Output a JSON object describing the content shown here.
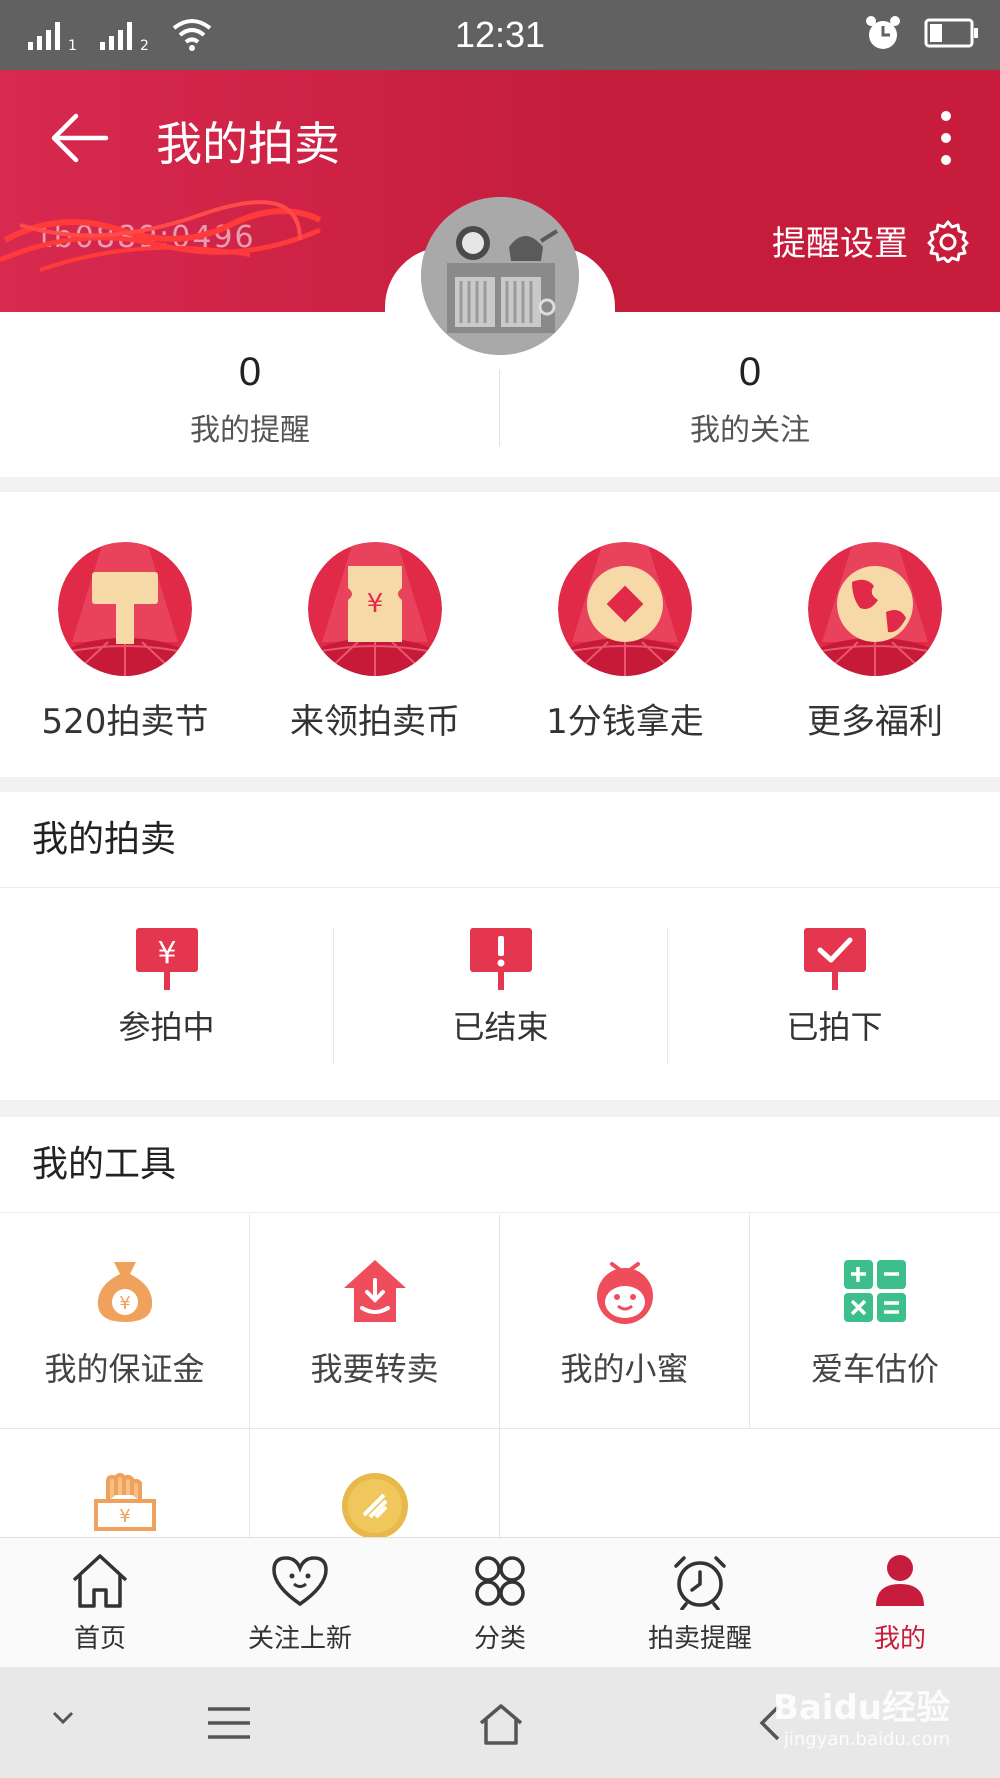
{
  "status_bar": {
    "time": "12:31"
  },
  "header": {
    "title": "我的拍卖",
    "username": "tb0889:0496",
    "remind_settings_label": "提醒设置"
  },
  "stats": [
    {
      "value": "0",
      "label": "我的提醒"
    },
    {
      "value": "0",
      "label": "我的关注"
    }
  ],
  "benefits": [
    {
      "label": "520拍卖节",
      "icon": "gavel-icon"
    },
    {
      "label": "来领拍卖币",
      "icon": "ticket-yuan-icon"
    },
    {
      "label": "1分钱拿走",
      "icon": "coin-icon"
    },
    {
      "label": "更多福利",
      "icon": "globe-icon"
    }
  ],
  "my_auction": {
    "title": "我的拍卖",
    "items": [
      {
        "label": "参拍中",
        "icon": "yuan-sign-icon"
      },
      {
        "label": "已结束",
        "icon": "exclamation-sign-icon"
      },
      {
        "label": "已拍下",
        "icon": "check-sign-icon"
      }
    ]
  },
  "my_tools": {
    "title": "我的工具",
    "items": [
      {
        "label": "我的保证金",
        "icon": "money-bag-icon"
      },
      {
        "label": "我要转卖",
        "icon": "house-resell-icon"
      },
      {
        "label": "我的小蜜",
        "icon": "assistant-face-icon"
      },
      {
        "label": "爱车估价",
        "icon": "calculator-icon"
      }
    ]
  },
  "tab_bar": {
    "items": [
      {
        "label": "首页",
        "icon": "home-icon"
      },
      {
        "label": "关注上新",
        "icon": "heart-icon"
      },
      {
        "label": "分类",
        "icon": "grid-icon"
      },
      {
        "label": "拍卖提醒",
        "icon": "alarm-clock-icon"
      },
      {
        "label": "我的",
        "icon": "person-icon"
      }
    ]
  },
  "watermark": {
    "line1": "Baidu经验",
    "line2": "jingyan.baidu.com"
  },
  "colors": {
    "brand": "#c81c3c",
    "accent_red": "#e4364f",
    "tool_orange": "#f0a25c",
    "tool_green": "#3cbf8a"
  }
}
